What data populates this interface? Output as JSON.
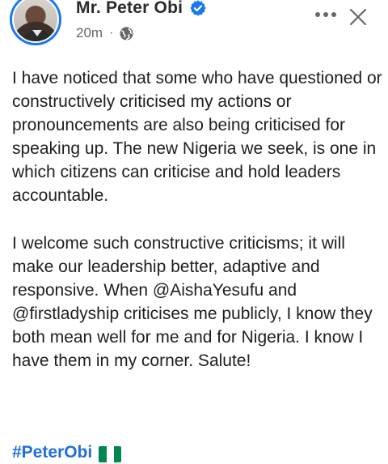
{
  "post": {
    "author": "Mr. Peter Obi",
    "timestamp": "20m",
    "separator": "·",
    "paragraphs": [
      "I have noticed that some who have questioned or constructively criticised my actions or pronouncements are also being criticised for speaking up. The new Nigeria we seek, is one in which citizens can criticise and hold leaders accountable.",
      "I welcome such constructive criticisms; it will make our leadership better, adaptive and responsive. When @AishaYesufu and @firstladyship criticises me publicly, I know they both mean well for me and for Nigeria. I know I have them in my corner. Salute!"
    ],
    "hashtag": "#PeterObi"
  },
  "icons": {
    "verified": "verified-badge-icon",
    "audience": "globe-icon",
    "more": "more-options-icon",
    "close": "close-icon",
    "flag": "nigeria-flag-icon"
  },
  "colors": {
    "accent": "#1877f2",
    "hashtag": "#216fdb",
    "text": "#1c1e21",
    "meta": "#65676b",
    "flag_green": "#008751",
    "flag_white": "#ffffff"
  }
}
